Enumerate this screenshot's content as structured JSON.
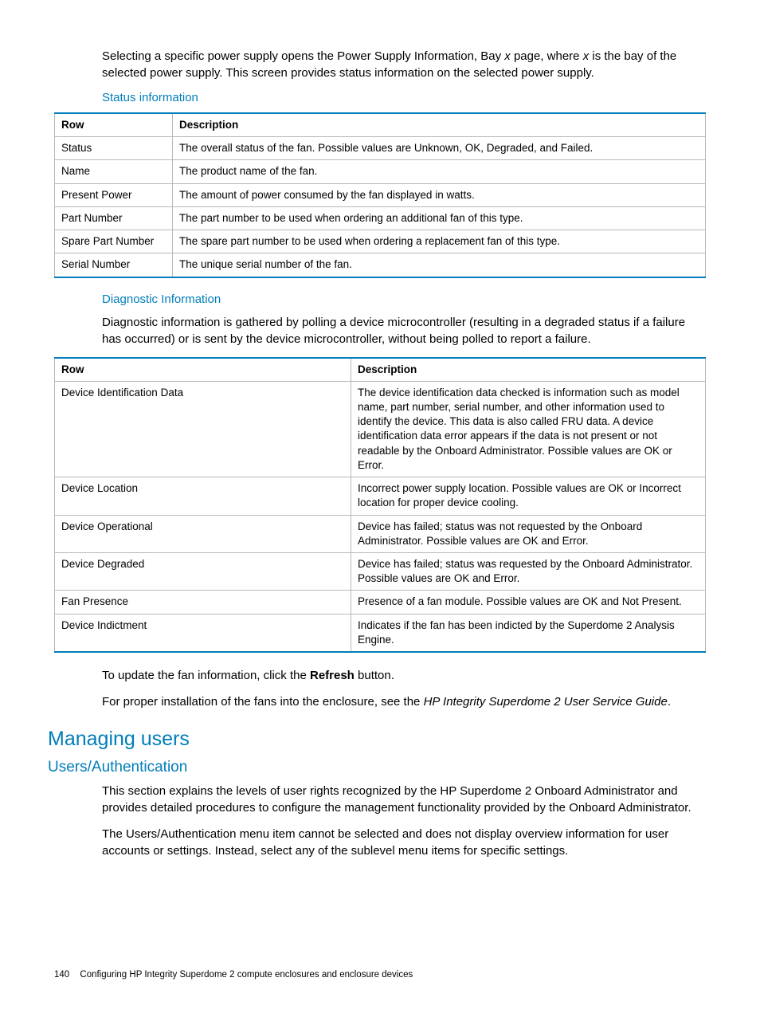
{
  "intro_html": "Selecting a specific power supply opens the Power Supply Information, Bay <span class='italic'>x</span> page, where <span class='italic'>x</span> is the bay of the selected power supply. This screen provides status information on the selected power supply.",
  "status_heading": "Status information",
  "table1": {
    "headers": [
      "Row",
      "Description"
    ],
    "rows": [
      [
        "Status",
        "The overall status of the fan. Possible values are Unknown, OK, Degraded, and Failed."
      ],
      [
        "Name",
        "The product name of the fan."
      ],
      [
        "Present Power",
        "The amount of power consumed by the fan displayed in watts."
      ],
      [
        "Part Number",
        "The part number to be used when ordering an additional fan of this type."
      ],
      [
        "Spare Part Number",
        "The spare part number to be used when ordering a replacement fan of this type."
      ],
      [
        "Serial Number",
        "The unique serial number of the fan."
      ]
    ]
  },
  "diag_heading": "Diagnostic Information",
  "diag_para": "Diagnostic information is gathered by polling a device microcontroller (resulting in a degraded status if a failure has occurred) or is sent by the device microcontroller, without being polled to report a failure.",
  "table2": {
    "headers": [
      "Row",
      "Description"
    ],
    "rows": [
      [
        "Device Identification Data",
        "The device identification data checked is information such as model name, part number, serial number, and other information used to identify the device. This data is also called FRU data. A device identification data error appears if the data is not present or not readable by the Onboard Administrator. Possible values are OK or Error."
      ],
      [
        "Device Location",
        "Incorrect power supply location. Possible values are OK or Incorrect location for proper device cooling."
      ],
      [
        "Device Operational",
        "Device has failed; status was not requested by the Onboard Administrator. Possible values are OK and Error."
      ],
      [
        "Device Degraded",
        "Device has failed; status was requested by the Onboard Administrator. Possible values are OK and Error."
      ],
      [
        "Fan Presence",
        "Presence of a fan module. Possible values are OK and Not Present."
      ],
      [
        "Device Indictment",
        "Indicates if the fan has been indicted by the Superdome 2 Analysis Engine."
      ]
    ]
  },
  "update_html": "To update the fan information, click the <span class='bold'>Refresh</span> button.",
  "install_html": "For proper installation of the fans into the enclosure, see the <span class='italic'>HP Integrity Superdome 2 User Service Guide</span>.",
  "h1": "Managing users",
  "h2": "Users/Authentication",
  "users_p1": "This section explains the levels of user rights recognized by the HP Superdome 2 Onboard Administrator and provides detailed procedures to configure the management functionality provided by the Onboard Administrator.",
  "users_p2": "The Users/Authentication menu item cannot be selected and does not display overview information for user accounts or settings. Instead, select any of the sublevel menu items for specific settings.",
  "footer": {
    "page": "140",
    "chapter": "Configuring HP Integrity Superdome 2 compute enclosures and enclosure devices"
  }
}
